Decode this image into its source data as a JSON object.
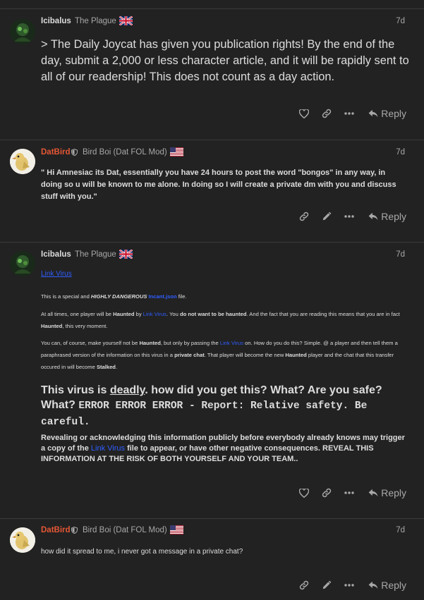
{
  "posts": [
    {
      "username": "Icibalus",
      "title": "The Plague",
      "date": "7d",
      "body": "> The Daily Joycat has given you publication rights! By the end of the day, submit a 2,000 or less character article, and it will be rapidly sent to all of our readership! This does not count as a day action.",
      "reply_label": "Reply"
    },
    {
      "username": "DatBird",
      "title": "Bird Boi (Dat FOL Mod)",
      "date": "7d",
      "body": "\" Hi Amnesiac its Dat, essentially you have 24 hours to post the word \"bongos\" in any way, in doing so u will be known to me alone. In doing so I will create a private dm with you and discuss stuff with you.\"",
      "reply_label": "Reply"
    },
    {
      "username": "Icibalus",
      "title": "The Plague",
      "date": "7d",
      "link_virus": "Link Virus",
      "p1_a": "This is a special and ",
      "p1_b": "HIGHLY DANGEROUS",
      "p1_c": "Incant.json",
      "p1_d": " file.",
      "p2_a": "At all times, one player will be ",
      "p2_b": "Haunted",
      "p2_c": " by ",
      "p2_d": "Link Virus",
      "p2_e": ". You ",
      "p2_f": "do not want to be haunted",
      "p2_g": ". And the fact that you are reading this means that you are in fact ",
      "p2_h": "Haunted",
      "p2_i": ", this very moment.",
      "p3_a": "You can, of course, make yourself not be ",
      "p3_b": "Haunted",
      "p3_c": ", but only by passing the ",
      "p3_d": "Link Virus",
      "p3_e": " on. How do you do this? Simple. @ a player and then tell them a paraphrased version of the information on this virus in a ",
      "p3_f": "private chat",
      "p3_g": ". That player will become the new ",
      "p3_h": "Haunted",
      "p3_i": " player and the chat that this transfer occured in will become ",
      "p3_j": "Stalked",
      "p3_k": ".",
      "h_a": "This virus is ",
      "h_b": "deadly",
      "h_c": ". how did you get this? What? Are you safe? What? ",
      "h_mono": "ERROR ERROR ERROR - Report: Relative safety. Be careful.",
      "w_a": "Revealing or acknowledging this information publicly before everybody already knows may trigger a copy of the ",
      "w_b": "Link Virus",
      "w_c": " file to appear, or have other negative consequences. REVEAL THIS INFORMATION AT THE RISK OF BOTH YOURSELF AND YOUR TEAM..",
      "reply_label": "Reply"
    },
    {
      "username": "DatBird",
      "title": "Bird Boi (Dat FOL Mod)",
      "date": "7d",
      "body": "how did it spread to me, i never got a message in a private chat?",
      "reply_label": "Reply"
    }
  ],
  "colors": {
    "background": "#222222",
    "text": "#dddddd",
    "muted": "#a8a8a8",
    "moderator_name": "#e45735",
    "link": "#2e5dff",
    "divider": "#3a3a3a"
  }
}
